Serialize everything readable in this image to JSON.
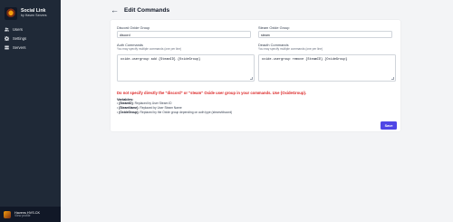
{
  "sidebar": {
    "brand_title": "Social Link",
    "brand_subtitle": "by Haven Servers",
    "items": [
      {
        "label": "Users",
        "icon": "users-icon"
      },
      {
        "label": "Settings",
        "icon": "gear-icon"
      },
      {
        "label": "Servers",
        "icon": "server-icon"
      }
    ],
    "user": {
      "name": "Havens HVS.CK",
      "link": "View profile"
    }
  },
  "header": {
    "back_icon": "arrow-left-icon",
    "title": "Edit Commands"
  },
  "form": {
    "discord_group_label": "Discord Oxide Group",
    "discord_group_value": "discord",
    "steam_group_label": "Steam Oxide Group",
    "steam_group_value": "steam",
    "auth_label": "Auth Commands",
    "auth_hint": "You may specify multiple commands (one per line)",
    "auth_value": "oxide.usergroup add {SteamID} {OxideGroup}",
    "deauth_label": "Deauth Commands",
    "deauth_hint": "You may specify multiple commands (one per line)",
    "deauth_value": "oxide.usergroup remove {SteamID} {OxideGroup}",
    "warning": "Do not specify directly the \"discord\" or \"steam\" Oxide user group in your commands. Use {OxideGroup}.",
    "variables_title": "Variables:",
    "variables": [
      {
        "name": "{SteamID}",
        "desc": ": Replaced by User Steam ID"
      },
      {
        "name": "{SteamName}",
        "desc": ": Replaced by User Steam Name"
      },
      {
        "name": "{OxideGroup}",
        "desc": ": Replaced by the Oxide group depending on auth type (steam/discord)"
      }
    ],
    "save_label": "Save"
  },
  "colors": {
    "sidebar": "#1f2937",
    "accent": "#4f46e5",
    "warning": "#dc2626"
  }
}
